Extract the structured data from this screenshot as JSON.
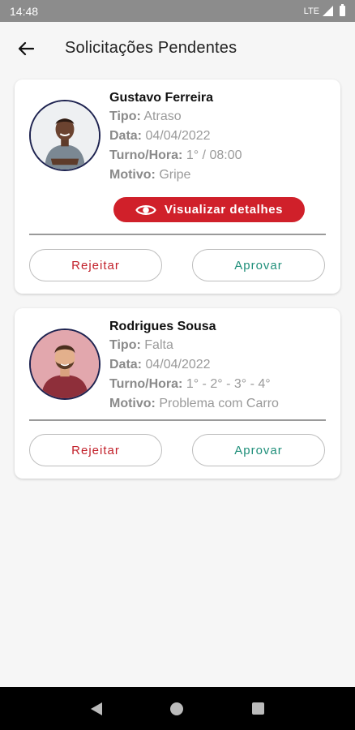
{
  "status_bar": {
    "time": "14:48",
    "network": "LTE"
  },
  "header": {
    "title": "Solicitações Pendentes",
    "back_icon": "arrow-left-icon"
  },
  "labels": {
    "tipo": "Tipo:",
    "data": "Data:",
    "turno_hora": "Turno/Hora:",
    "motivo": "Motivo:"
  },
  "requests": [
    {
      "name": "Gustavo Ferreira",
      "tipo": "Atraso",
      "data": "04/04/2022",
      "turno_hora": "1° / 08:00",
      "motivo": "Gripe",
      "details_label": "Visualizar detalhes",
      "reject_label": "Rejeitar",
      "approve_label": "Aprovar"
    },
    {
      "name": "Rodrigues Sousa",
      "tipo": "Falta",
      "data": "04/04/2022",
      "turno_hora": "1° - 2° - 3° - 4°",
      "motivo": "Problema com Carro",
      "reject_label": "Rejeitar",
      "approve_label": "Aprovar"
    }
  ],
  "colors": {
    "accent_red": "#d0202a",
    "approve_green": "#1f8f7a",
    "avatar_border": "#1e2350"
  }
}
